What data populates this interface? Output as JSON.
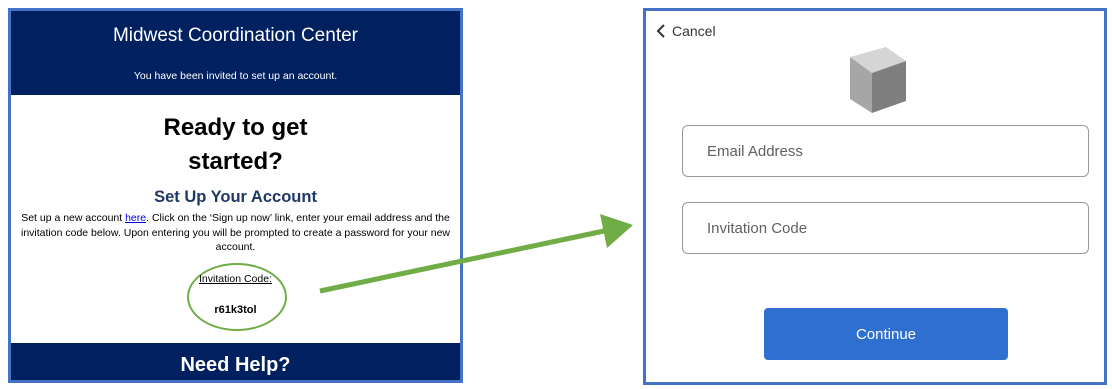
{
  "email": {
    "title": "Midwest Coordination Center",
    "subtitle": "You have been invited to set up an account.",
    "heading_line1": "Ready to get",
    "heading_line2": "started?",
    "setup_heading": "Set Up Your Account",
    "instructions_prefix": "Set up a new account ",
    "instructions_link": "here",
    "instructions_suffix": ". Click on the ‘Sign up now’ link, enter your email address and the invitation code below. Upon entering you will be prompted to create a password for your new account.",
    "code_label": "Invitation Code:",
    "code_value": "r61k3tol",
    "footer": "Need Help?"
  },
  "form": {
    "cancel_label": "Cancel",
    "email_placeholder": "Email Address",
    "code_placeholder": "Invitation Code",
    "continue_label": "Continue"
  },
  "colors": {
    "navy": "#002060",
    "panel_border": "#4472c4",
    "highlight_green": "#70ad47",
    "button_blue": "#2f6fcf"
  },
  "icons": [
    "chevron-left-icon",
    "cube-logo-icon",
    "arrow-icon"
  ]
}
